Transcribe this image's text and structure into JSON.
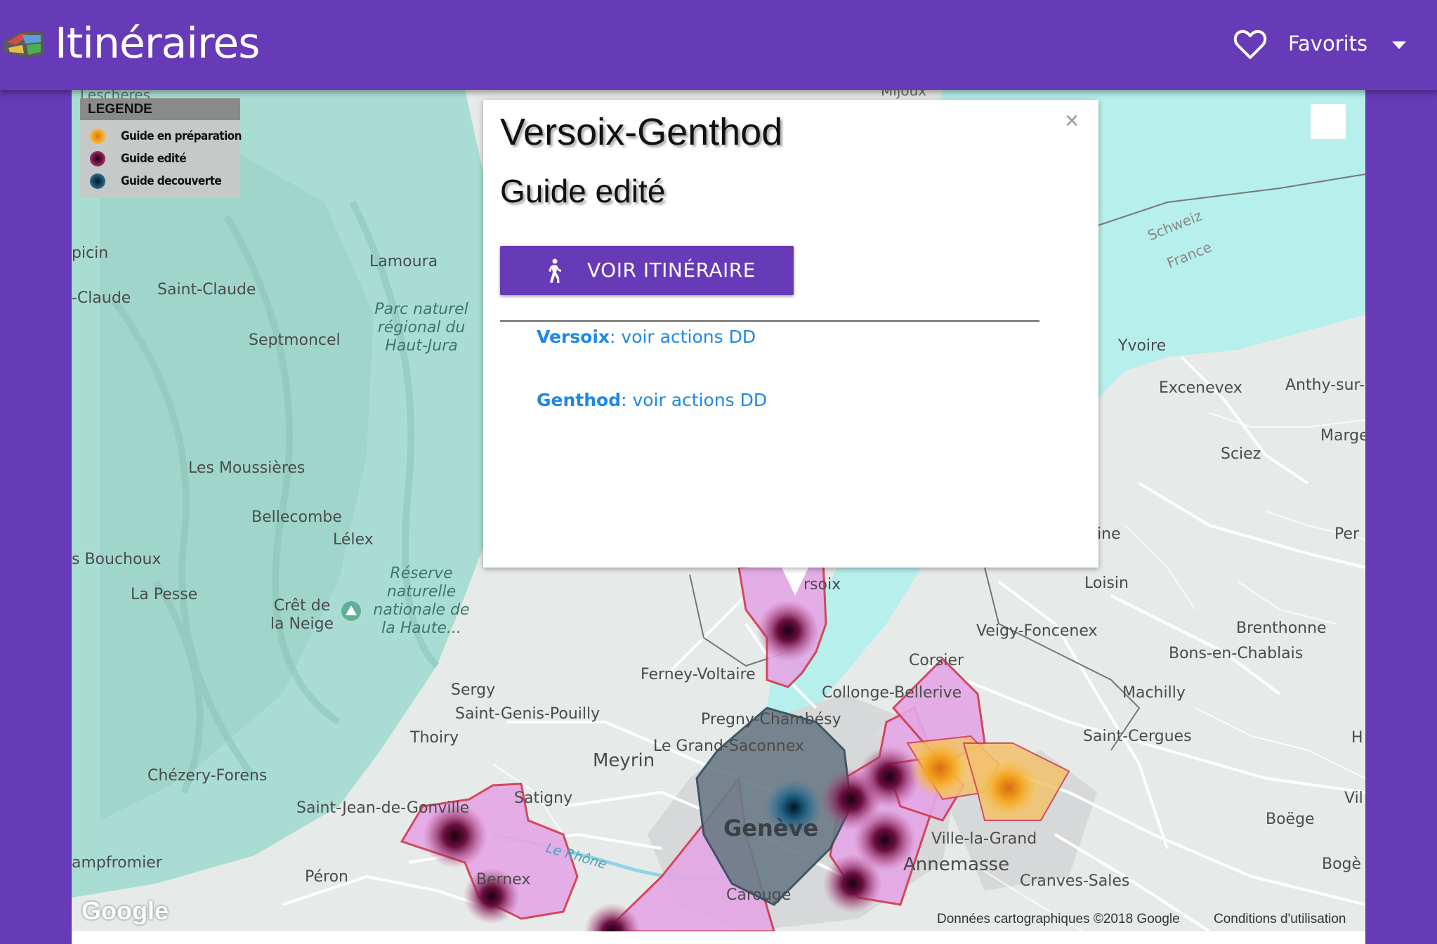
{
  "header": {
    "title": "Itinéraires",
    "favorites_label": "Favorits"
  },
  "legend": {
    "title": "LEGENDE",
    "items": [
      {
        "label": "Guide en préparation",
        "color": "#f4a522"
      },
      {
        "label": "Guide edité",
        "color": "#7a1347"
      },
      {
        "label": "Guide decouverte",
        "color": "#1b4d6b"
      }
    ]
  },
  "popup": {
    "title": "Versoix-Genthod",
    "subtitle": "Guide edité",
    "route_button": "VOIR ITINÉRAIRE",
    "close_glyph": "×",
    "links": [
      {
        "town": "Versoix",
        "text": ": voir actions DD"
      },
      {
        "town": "Genthod",
        "text": ": voir actions DD"
      }
    ]
  },
  "map": {
    "labels": [
      "Lescheres",
      "Mijoux",
      "Lamoura",
      "Saint-Claude",
      "-Claude",
      "picin",
      "Septmoncel",
      "Parc naturel régional du Haut-Jura",
      "Les Moussières",
      "Bellecombe",
      "Lélex",
      "s Bouchoux",
      "La Pesse",
      "Crêt de la Neige",
      "Réserve naturelle nationale de la Haute...",
      "Sergy",
      "Saint-Genis-Pouilly",
      "Thoiry",
      "Ferney-Voltaire",
      "Pregny-Chambésy",
      "Le Grand-Saconnex",
      "Meyrin",
      "Chézery-Forens",
      "Satigny",
      "Saint-Jean-de-Gonville",
      "ampfromier",
      "Péron",
      "Le Rhône",
      "Bernex",
      "Genève",
      "Carouge",
      "Annemasse",
      "Ville-la-Grand",
      "Cranves-Sales",
      "Collonge-Bellerive",
      "Corsier",
      "Veigy-Foncenex",
      "Loisin",
      "Brenthonne",
      "Bons-en-Chablais",
      "Machilly",
      "Saint-Cergues",
      "Boëge",
      "Bogè",
      "Yvoire",
      "Excenevex",
      "Anthy-sur-L",
      "Sciez",
      "Marge",
      "Schweiz",
      "France",
      "ine",
      "Per",
      "H",
      "Vil",
      "rsoix"
    ],
    "credits": "Données cartographiques ©2018 Google",
    "terms": "Conditions d'utilisation",
    "google_logo": "Google"
  }
}
